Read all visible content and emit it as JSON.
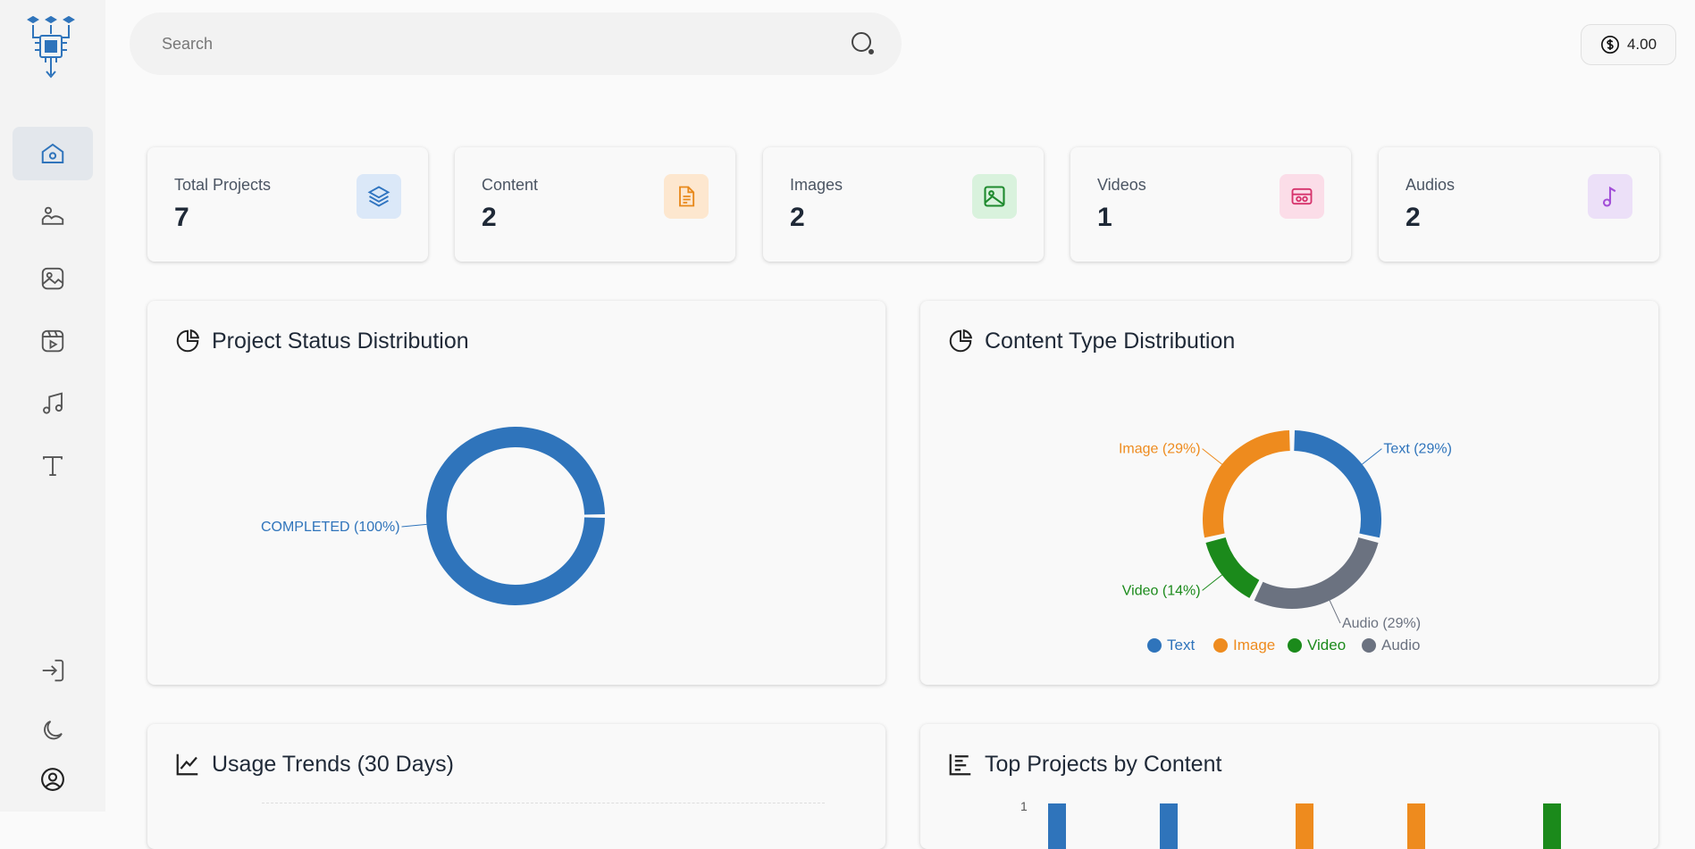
{
  "search": {
    "placeholder": "Search"
  },
  "balance": {
    "value": "4.00"
  },
  "sidebar": {
    "items": [
      {
        "name": "home",
        "icon": "home-icon",
        "active": true
      },
      {
        "name": "landscape",
        "icon": "mountain-icon"
      },
      {
        "name": "images",
        "icon": "image-icon"
      },
      {
        "name": "videos",
        "icon": "video-icon"
      },
      {
        "name": "audio",
        "icon": "music-icon"
      },
      {
        "name": "text",
        "icon": "text-icon"
      }
    ],
    "bottom": [
      {
        "name": "login",
        "icon": "login-icon"
      },
      {
        "name": "theme",
        "icon": "moon-icon"
      },
      {
        "name": "profile",
        "icon": "user-circle-icon"
      }
    ]
  },
  "stats": [
    {
      "label": "Total Projects",
      "value": "7",
      "icon": "layers-icon",
      "bg": "#dbe8f8",
      "color": "#2f74c0"
    },
    {
      "label": "Content",
      "value": "2",
      "icon": "document-icon",
      "bg": "#fde7cf",
      "color": "#e8891c"
    },
    {
      "label": "Images",
      "value": "2",
      "icon": "image-icon",
      "bg": "#d9f2dd",
      "color": "#1e8a2e"
    },
    {
      "label": "Videos",
      "value": "1",
      "icon": "video-icon",
      "bg": "#fbdde8",
      "color": "#d6336c"
    },
    {
      "label": "Audios",
      "value": "2",
      "icon": "music-icon",
      "bg": "#ece0f8",
      "color": "#a24fd8"
    }
  ],
  "panels": {
    "status": {
      "title": "Project Status Distribution"
    },
    "content_type": {
      "title": "Content Type Distribution"
    },
    "usage": {
      "title": "Usage Trends (30 Days)"
    },
    "top_projects": {
      "title": "Top Projects by Content"
    }
  },
  "chart_data": [
    {
      "type": "pie",
      "title": "Project Status Distribution",
      "slices": [
        {
          "label": "COMPLETED (100%)",
          "value": 100,
          "color": "#2f74bb"
        }
      ]
    },
    {
      "type": "pie",
      "title": "Content Type Distribution",
      "slices": [
        {
          "label": "Text (29%)",
          "legend": "Text",
          "value": 29,
          "color": "#2f74bb"
        },
        {
          "label": "Audio (29%)",
          "legend": "Audio",
          "value": 29,
          "color": "#6b7280"
        },
        {
          "label": "Video (14%)",
          "legend": "Video",
          "value": 14,
          "color": "#1b8a1b"
        },
        {
          "label": "Image (29%)",
          "legend": "Image",
          "value": 29,
          "color": "#ee8b1e"
        }
      ],
      "legend_position": "bottom"
    }
  ],
  "top_projects_partial": {
    "y_tick": "1"
  }
}
